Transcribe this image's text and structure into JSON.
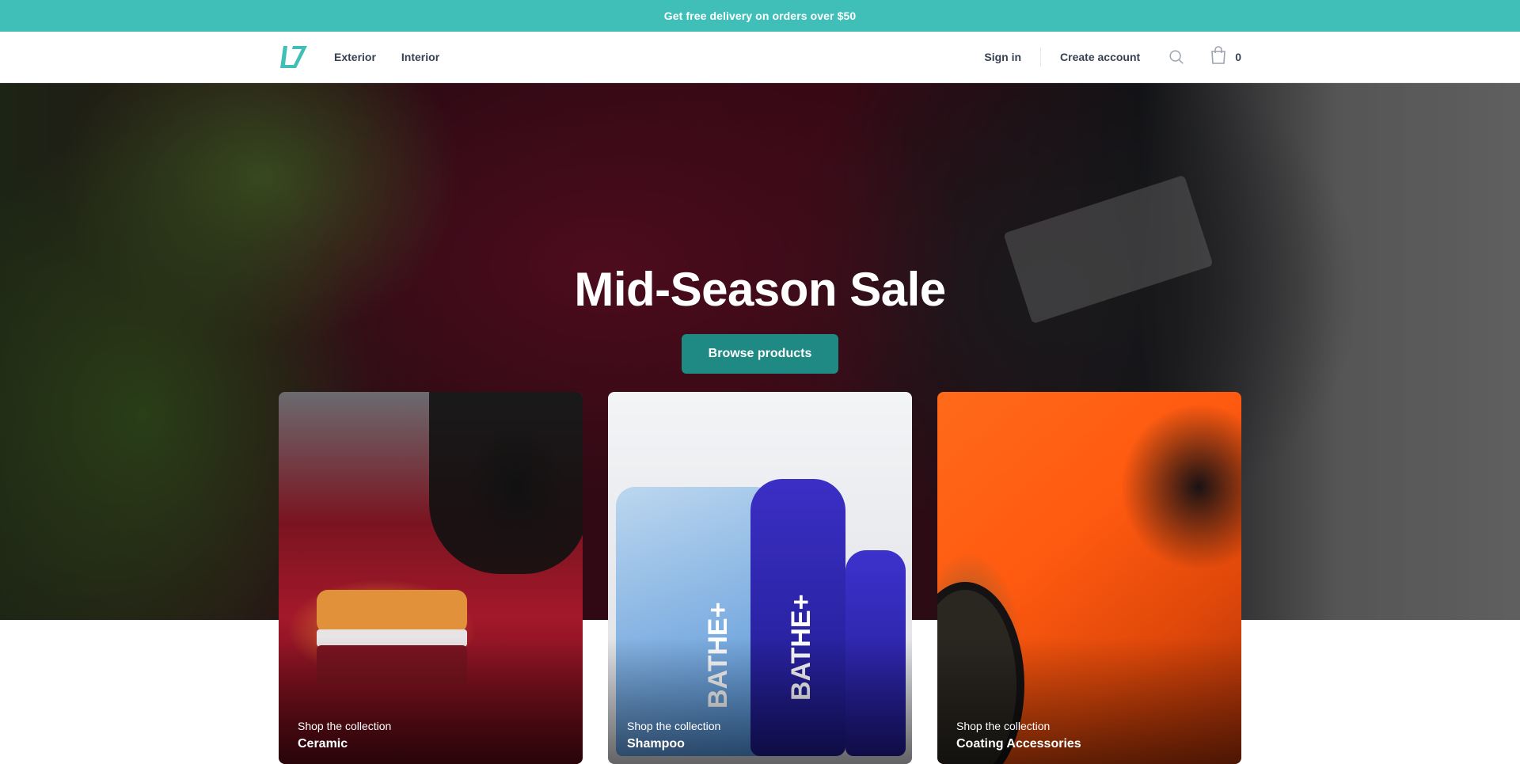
{
  "promo": {
    "text": "Get free delivery on orders over $50"
  },
  "brand": {
    "logo_name": "L7"
  },
  "nav": {
    "links": [
      {
        "label": "Exterior"
      },
      {
        "label": "Interior"
      }
    ],
    "sign_in": "Sign in",
    "create_account": "Create account",
    "cart_count": "0"
  },
  "hero": {
    "title": "Mid-Season Sale",
    "cta": "Browse products"
  },
  "collections": [
    {
      "kicker": "Shop the collection",
      "title": "Ceramic"
    },
    {
      "kicker": "Shop the collection",
      "title": "Shampoo"
    },
    {
      "kicker": "Shop the collection",
      "title": "Coating Accessories"
    }
  ],
  "colors": {
    "accent": "#40bfb8",
    "button": "#1f8a83",
    "text": "#374151"
  },
  "icons": {
    "logo": "brand-logo-icon",
    "search": "search-icon",
    "cart": "shopping-bag-icon"
  },
  "product_labels": {
    "shampoo_brand": "BATHE+"
  }
}
